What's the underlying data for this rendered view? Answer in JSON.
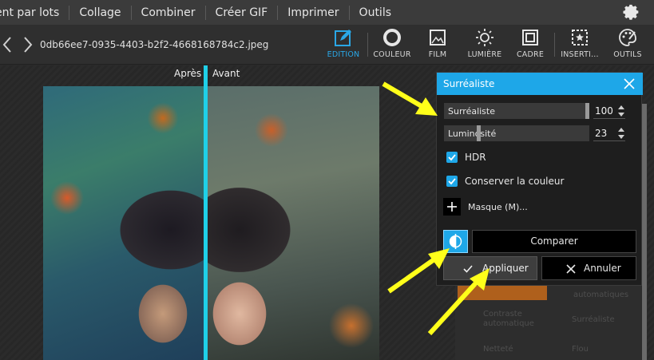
{
  "menu": {
    "items": [
      "ent par lots",
      "Collage",
      "Combiner",
      "Créer GIF",
      "Imprimer",
      "Outils"
    ]
  },
  "toolbar": {
    "filename": "0db66ee7-0935-4403-b2f2-4668168784c2.jpeg",
    "tools": [
      {
        "label": "EDITION",
        "icon": "edit-icon",
        "active": true
      },
      {
        "label": "COULEUR",
        "icon": "color-circle-icon",
        "active": false
      },
      {
        "label": "FILM",
        "icon": "film-icon",
        "active": false
      },
      {
        "label": "LUMIÈRE",
        "icon": "sun-icon",
        "active": false
      },
      {
        "label": "CADRE",
        "icon": "frame-icon",
        "active": false
      },
      {
        "label": "INSERTI...",
        "icon": "insert-icon",
        "active": false
      },
      {
        "label": "OUTILS",
        "icon": "palette-icon",
        "active": false
      }
    ],
    "accent": "#2aa7e6"
  },
  "canvas": {
    "label_after": "Après",
    "label_before": "Avant",
    "divider_color": "#1fd0e8"
  },
  "dialog": {
    "title": "Surréaliste",
    "header_color": "#1ea7e8",
    "sliders": [
      {
        "label": "Surréaliste",
        "value": "100",
        "level": 1.0
      },
      {
        "label": "Luminosité",
        "value": "23",
        "level": 0.23
      }
    ],
    "checkboxes": [
      {
        "label": "HDR",
        "checked": true
      },
      {
        "label": "Conserver la couleur",
        "checked": true
      }
    ],
    "mask_label": "Masque (M)...",
    "compare_label": "Comparer",
    "apply_label": "Appliquer",
    "cancel_label": "Annuler"
  },
  "background_panel": {
    "items": [
      "automatiques",
      "Contraste automatique",
      "Surréaliste",
      "Netteté",
      "Flou"
    ]
  }
}
